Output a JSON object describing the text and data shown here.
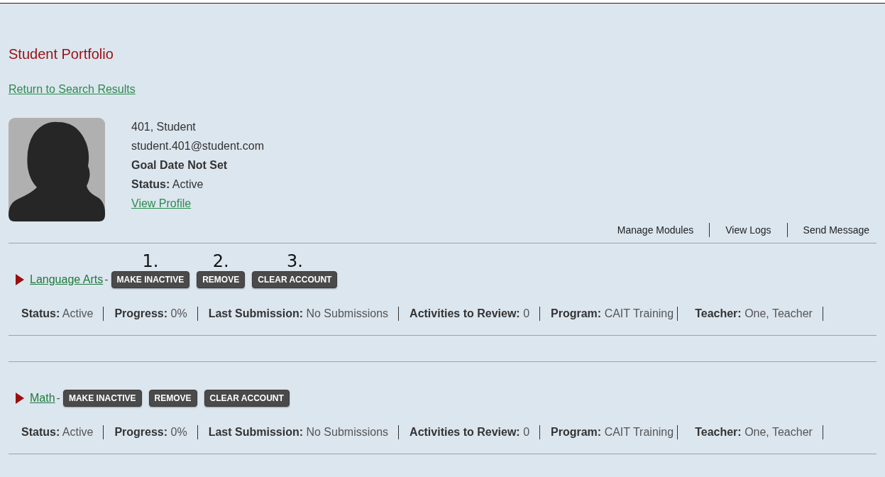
{
  "title": "Student Portfolio",
  "back_link": "Return to Search Results",
  "student": {
    "name": "401, Student",
    "email": "student.401@student.com",
    "goal": "Goal Date Not Set",
    "status_label": "Status:",
    "status_value": "Active",
    "profile_link": "View Profile"
  },
  "actions": [
    "Manage Modules",
    "View Logs",
    "Send Message"
  ],
  "courses": [
    {
      "name": "Language Arts ",
      "separator": "-",
      "buttons": [
        {
          "label": "MAKE INACTIVE",
          "annotation": "1."
        },
        {
          "label": "REMOVE",
          "annotation": "2."
        },
        {
          "label": "CLEAR ACCOUNT",
          "annotation": "3."
        }
      ],
      "stats": [
        {
          "label": "Status:",
          "value": "Active"
        },
        {
          "label": "Progress:",
          "value": "0%"
        },
        {
          "label": "Last Submission:",
          "value": "No Submissions"
        },
        {
          "label": "Activities to Review:",
          "value": "0"
        },
        {
          "label": "Program:",
          "value": "CAIT Training"
        },
        {
          "label": "Teacher:",
          "value": "One, Teacher"
        }
      ]
    },
    {
      "name": "Math ",
      "separator": "-",
      "buttons": [
        {
          "label": "MAKE INACTIVE"
        },
        {
          "label": "REMOVE"
        },
        {
          "label": "CLEAR ACCOUNT"
        }
      ],
      "stats": [
        {
          "label": "Status:",
          "value": "Active"
        },
        {
          "label": "Progress:",
          "value": "0%"
        },
        {
          "label": "Last Submission:",
          "value": "No Submissions"
        },
        {
          "label": "Activities to Review:",
          "value": "0"
        },
        {
          "label": "Program:",
          "value": "CAIT Training"
        },
        {
          "label": "Teacher:",
          "value": "One, Teacher"
        }
      ]
    }
  ]
}
